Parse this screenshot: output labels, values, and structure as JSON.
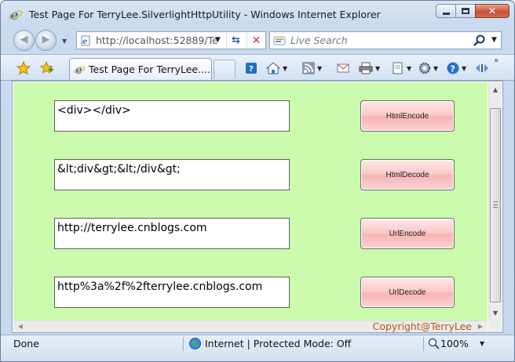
{
  "window": {
    "title": "Test Page For TerryLee.SilverlightHttpUtility - Windows Internet Explorer"
  },
  "nav": {
    "address_url": "http://localhost:52889/Te",
    "search_placeholder": "Live Search"
  },
  "tab": {
    "label": "Test Page For TerryLee...."
  },
  "commands": [
    "home-icon",
    "feeds-icon",
    "read-mail-icon",
    "print-icon",
    "page-icon",
    "tools-icon",
    "help-icon",
    "research-icon"
  ],
  "content": {
    "background_color": "#ccfaad",
    "rows": [
      {
        "text": "<div></div>",
        "button": "HtmlEncode"
      },
      {
        "text": "&lt;div&gt;&lt;/div&gt;",
        "button": "HtmlDecode"
      },
      {
        "text": "http://terrylee.cnblogs.com",
        "button": "UrlEncode"
      },
      {
        "text": "http%3a%2f%2fterrylee.cnblogs.com",
        "button": "UrlDecode"
      }
    ],
    "copyright": "Copyright@TerryLee"
  },
  "status": {
    "left": "Done",
    "zone": "Internet | Protected Mode: Off",
    "zoom": "100%"
  }
}
